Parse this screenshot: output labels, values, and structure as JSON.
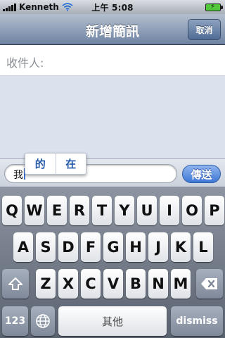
{
  "status_bar": {
    "carrier": "Kenneth",
    "time": "上午 5:08"
  },
  "nav": {
    "title": "新增簡訊",
    "cancel_label": "取消"
  },
  "recipient": {
    "label": "收件人:"
  },
  "compose": {
    "input_value": "我",
    "send_label": "傳送"
  },
  "candidates": [
    "的",
    "在"
  ],
  "keyboard": {
    "row1": [
      "Q",
      "W",
      "E",
      "R",
      "T",
      "Y",
      "U",
      "I",
      "O",
      "P"
    ],
    "row2": [
      "A",
      "S",
      "D",
      "F",
      "G",
      "H",
      "J",
      "K",
      "L"
    ],
    "row3": [
      "Z",
      "X",
      "C",
      "V",
      "B",
      "N",
      "M"
    ],
    "numbers_label": "123",
    "space_label": "其他",
    "dismiss_label": "dismiss",
    "shift_icon": "shift-arrow-icon",
    "backspace_icon": "backspace-icon",
    "globe_icon": "globe-icon"
  },
  "colors": {
    "nav_bar": "#6e83a3",
    "send_button": "#3f78d6",
    "battery": "#52c93a"
  }
}
